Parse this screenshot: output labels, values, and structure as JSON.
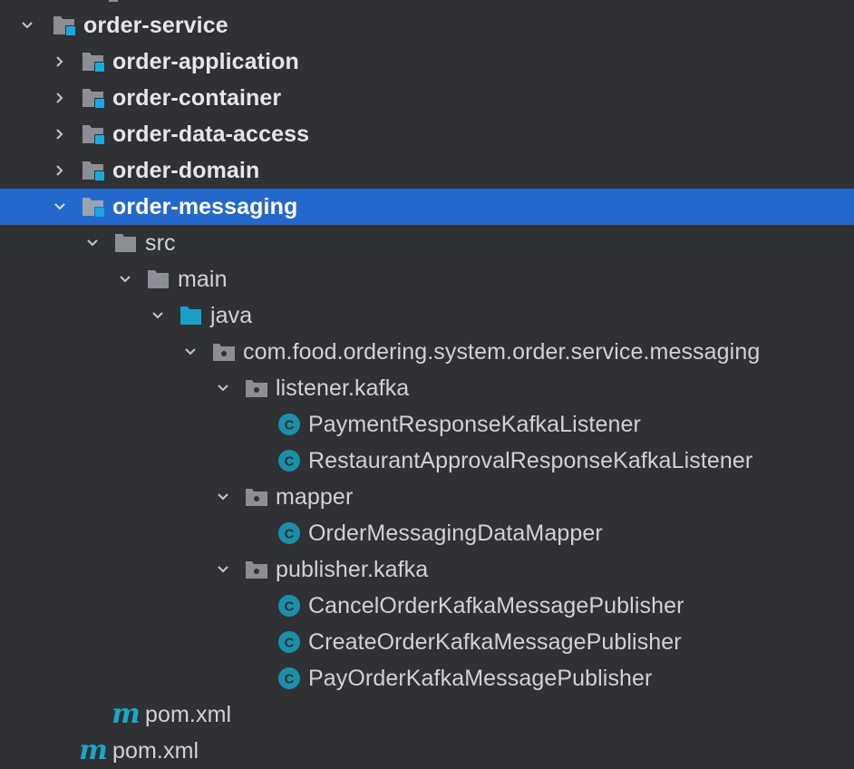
{
  "colors": {
    "background": "#2f3134",
    "selection": "#2468cc",
    "folder_gray": "#8b8e94",
    "module_badge": "#1ba8e0",
    "source_folder": "#1b9ec8",
    "class_icon": "#1c8fa8",
    "text": "#d0d2d6"
  },
  "tree": {
    "items": [
      {
        "label": "order-service",
        "icon": "module-folder-icon",
        "expanded": true,
        "bold": true
      },
      {
        "label": "order-application",
        "icon": "module-folder-icon",
        "expanded": false,
        "bold": true
      },
      {
        "label": "order-container",
        "icon": "module-folder-icon",
        "expanded": false,
        "bold": true
      },
      {
        "label": "order-data-access",
        "icon": "module-folder-icon",
        "expanded": false,
        "bold": true
      },
      {
        "label": "order-domain",
        "icon": "module-folder-icon",
        "expanded": false,
        "bold": true
      },
      {
        "label": "order-messaging",
        "icon": "module-folder-icon",
        "expanded": true,
        "bold": true,
        "selected": true
      },
      {
        "label": "src",
        "icon": "folder-icon",
        "expanded": true
      },
      {
        "label": "main",
        "icon": "folder-icon",
        "expanded": true
      },
      {
        "label": "java",
        "icon": "source-folder-icon",
        "expanded": true
      },
      {
        "label": "com.food.ordering.system.order.service.messaging",
        "icon": "package-icon",
        "expanded": true
      },
      {
        "label": "listener.kafka",
        "icon": "package-icon",
        "expanded": true
      },
      {
        "label": "PaymentResponseKafkaListener",
        "icon": "class-icon"
      },
      {
        "label": "RestaurantApprovalResponseKafkaListener",
        "icon": "class-icon"
      },
      {
        "label": "mapper",
        "icon": "package-icon",
        "expanded": true
      },
      {
        "label": "OrderMessagingDataMapper",
        "icon": "class-icon"
      },
      {
        "label": "publisher.kafka",
        "icon": "package-icon",
        "expanded": true
      },
      {
        "label": "CancelOrderKafkaMessagePublisher",
        "icon": "class-icon"
      },
      {
        "label": "CreateOrderKafkaMessagePublisher",
        "icon": "class-icon"
      },
      {
        "label": "PayOrderKafkaMessagePublisher",
        "icon": "class-icon"
      },
      {
        "label": "pom.xml",
        "icon": "maven-icon"
      },
      {
        "label": "pom.xml",
        "icon": "maven-icon"
      }
    ],
    "class_glyph": "C",
    "maven_glyph": "m"
  }
}
